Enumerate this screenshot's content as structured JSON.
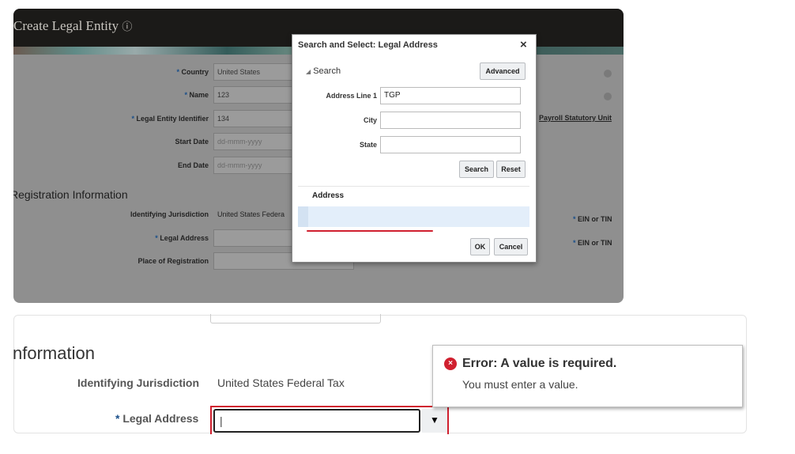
{
  "page": {
    "title": "Create Legal Entity",
    "help_icon": "help-circle-icon"
  },
  "form": {
    "country": {
      "label": "Country",
      "value": "United States"
    },
    "name": {
      "label": "Name",
      "value": "123"
    },
    "identifier": {
      "label": "Legal Entity Identifier",
      "value": "134"
    },
    "start_date": {
      "label": "Start Date",
      "placeholder": "dd-mmm-yyyy"
    },
    "end_date": {
      "label": "End Date",
      "placeholder": "dd-mmm-yyyy"
    },
    "payroll_link": "Payroll Statutory Unit"
  },
  "registration": {
    "title": "Registration Information",
    "jurisdiction_label": "Identifying Jurisdiction",
    "jurisdiction_value": "United States Federal Tax",
    "jurisdiction_value_clipped": "United States Federa",
    "legal_address_label": "Legal Address",
    "place_label": "Place of Registration",
    "ein_label": "EIN or TIN"
  },
  "dialog": {
    "title": "Search and Select: Legal Address",
    "close": "×",
    "search_section": "Search",
    "advanced": "Advanced",
    "address_line1_label": "Address Line 1",
    "address_line1_value": "TGP",
    "city_label": "City",
    "state_label": "State",
    "search_btn": "Search",
    "reset_btn": "Reset",
    "column_address": "Address",
    "ok": "OK",
    "cancel": "Cancel"
  },
  "zoom": {
    "section_title": "nformation",
    "error_title": "Error: A value is required.",
    "error_detail": "You must enter a value.",
    "dropdown_icon": "▼"
  },
  "colors": {
    "error": "#d0202f",
    "required": "#1a4f8a"
  }
}
